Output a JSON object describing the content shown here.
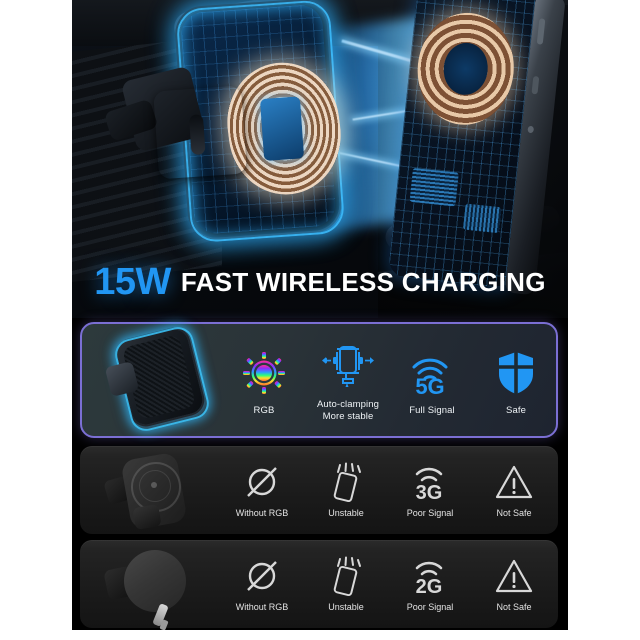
{
  "headline": {
    "power": "15W",
    "text": "FAST WIRELESS CHARGING"
  },
  "highlight_panel": {
    "border_color": "#7b6fd4",
    "product_name": "rgb-car-charger-mount",
    "features": [
      {
        "icon": "rgb-sun-icon",
        "label": "RGB"
      },
      {
        "icon": "auto-clamping-icon",
        "label": "Auto-clamping\nMore stable"
      },
      {
        "icon": "5g-signal-icon",
        "label": "Full Signal",
        "signal": "5G"
      },
      {
        "icon": "shield-icon",
        "label": "Safe"
      }
    ]
  },
  "comparison_rows": [
    {
      "product_name": "magsafe-style-mount",
      "features": [
        {
          "icon": "no-rgb-icon",
          "label": "Without RGB"
        },
        {
          "icon": "unstable-phone-icon",
          "label": "Unstable"
        },
        {
          "icon": "3g-signal-icon",
          "label": "Poor Signal",
          "signal": "3G"
        },
        {
          "icon": "warning-triangle-icon",
          "label": "Not Safe"
        }
      ]
    },
    {
      "product_name": "disc-mount",
      "features": [
        {
          "icon": "no-rgb-icon",
          "label": "Without RGB"
        },
        {
          "icon": "unstable-phone-icon",
          "label": "Unstable"
        },
        {
          "icon": "2g-signal-icon",
          "label": "Poor Signal",
          "signal": "2G"
        },
        {
          "icon": "warning-triangle-icon",
          "label": "Not Safe"
        }
      ]
    }
  ],
  "colors": {
    "accent_blue": "#2196f3",
    "panel_border": "#7b6fd4",
    "icon_blue": "#2196f3",
    "gray_icon": "#d8d8d8"
  }
}
